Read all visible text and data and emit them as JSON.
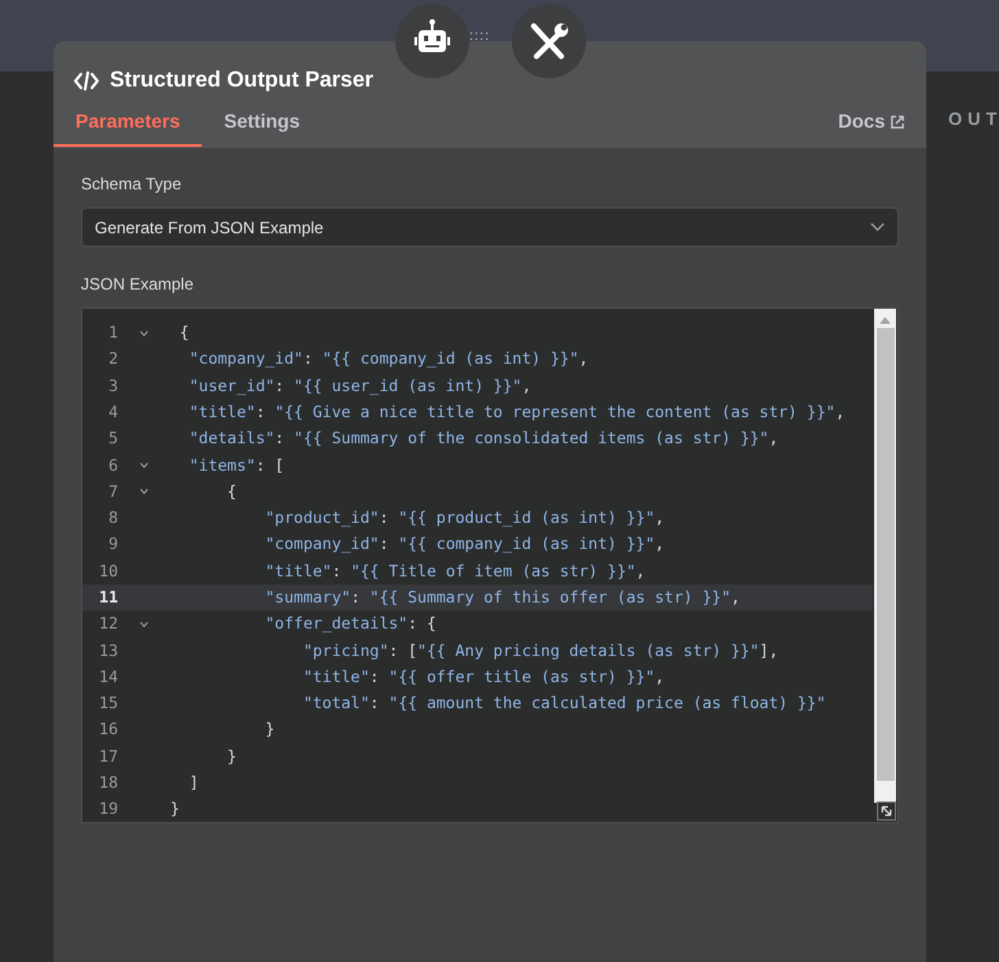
{
  "node_icons": {
    "connector": "::::"
  },
  "panel": {
    "title": "Structured Output Parser",
    "tabs": [
      {
        "label": "Parameters",
        "selected": true
      },
      {
        "label": "Settings",
        "selected": false
      }
    ],
    "docs_link": "Docs",
    "schema_type": {
      "label": "Schema Type",
      "value": "Generate From JSON Example"
    },
    "json_example": {
      "label": "JSON Example",
      "lines": [
        {
          "number": "1",
          "text": " {",
          "foldable": true,
          "active": false
        },
        {
          "number": "2",
          "text": "  \"company_id\": \"{{ company_id (as int) }}\",",
          "foldable": false,
          "active": false
        },
        {
          "number": "3",
          "text": "  \"user_id\": \"{{ user_id (as int) }}\",",
          "foldable": false,
          "active": false
        },
        {
          "number": "4",
          "text": "  \"title\": \"{{ Give a nice title to represent the content (as str) }}\",",
          "foldable": false,
          "active": false
        },
        {
          "number": "5",
          "text": "  \"details\": \"{{ Summary of the consolidated items (as str) }}\",",
          "foldable": false,
          "active": false
        },
        {
          "number": "6",
          "text": "  \"items\": [",
          "foldable": true,
          "active": false
        },
        {
          "number": "7",
          "text": "      {",
          "foldable": true,
          "active": false
        },
        {
          "number": "8",
          "text": "          \"product_id\": \"{{ product_id (as int) }}\",",
          "foldable": false,
          "active": false
        },
        {
          "number": "9",
          "text": "          \"company_id\": \"{{ company_id (as int) }}\",",
          "foldable": false,
          "active": false
        },
        {
          "number": "10",
          "text": "          \"title\": \"{{ Title of item (as str) }}\",",
          "foldable": false,
          "active": false
        },
        {
          "number": "11",
          "text": "          \"summary\": \"{{ Summary of this offer (as str) }}\",",
          "foldable": false,
          "active": true
        },
        {
          "number": "12",
          "text": "          \"offer_details\": {",
          "foldable": true,
          "active": false
        },
        {
          "number": "13",
          "text": "              \"pricing\": [\"{{ Any pricing details (as str) }}\"],",
          "foldable": false,
          "active": false
        },
        {
          "number": "14",
          "text": "              \"title\": \"{{ offer title (as str) }}\",",
          "foldable": false,
          "active": false
        },
        {
          "number": "15",
          "text": "              \"total\": \"{{ amount the calculated price (as float) }}\"",
          "foldable": false,
          "active": false
        },
        {
          "number": "16",
          "text": "          }",
          "foldable": false,
          "active": false
        },
        {
          "number": "17",
          "text": "      }",
          "foldable": false,
          "active": false
        },
        {
          "number": "18",
          "text": "  ]",
          "foldable": false,
          "active": false
        },
        {
          "number": "19",
          "text": "}",
          "foldable": false,
          "active": false
        }
      ]
    }
  },
  "output_heading": "OUT"
}
